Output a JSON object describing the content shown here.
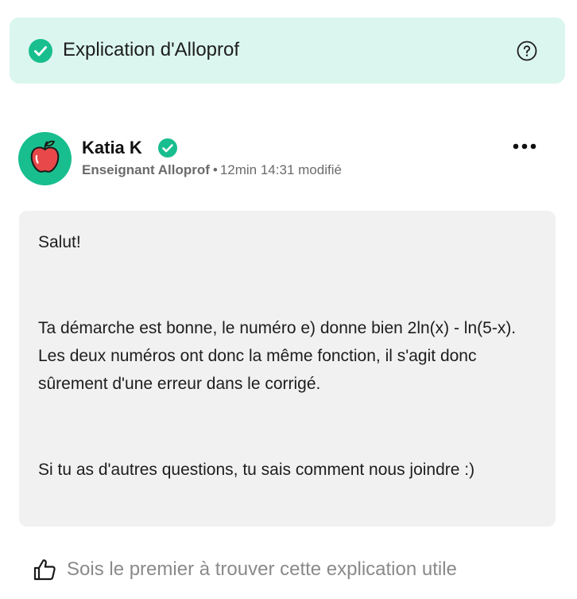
{
  "banner": {
    "title": "Explication d'Alloprof",
    "check_icon": "check-circle-icon",
    "help_icon": "question-circle-icon",
    "background_color": "#dbf6ee",
    "accent_color": "#18be8e"
  },
  "author": {
    "name": "Katia K",
    "avatar_icon": "apple-icon",
    "verified_icon": "verified-badge-icon",
    "role": "Enseignant Alloprof",
    "separator": "•",
    "time": "12min 14:31 modifié",
    "more_icon": "more-dots-icon"
  },
  "answer": {
    "greeting": "Salut!",
    "body": "Ta démarche est bonne, le numéro e) donne bien 2ln(x) - ln(5-x). Les deux numéros ont donc la même fonction, il s'agit donc sûrement d'une erreur dans le corrigé.",
    "closing": "Si tu as d'autres questions, tu sais comment nous joindre :)"
  },
  "feedback": {
    "like_icon": "thumbs-up-icon",
    "label": "Sois le premier à trouver cette explication utile"
  }
}
